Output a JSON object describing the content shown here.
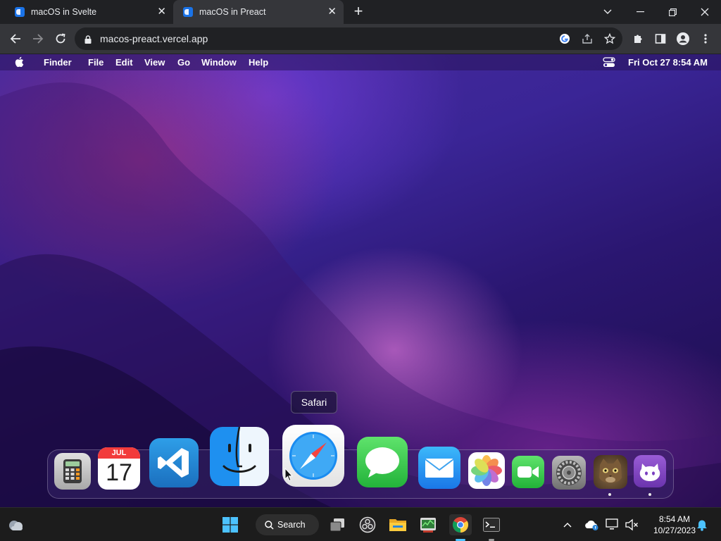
{
  "browser": {
    "tabs": [
      {
        "title": "macOS in Svelte",
        "active": false
      },
      {
        "title": "macOS in Preact",
        "active": true
      }
    ],
    "url": "macos-preact.vercel.app"
  },
  "menubar": {
    "app_name": "Finder",
    "items": [
      "File",
      "Edit",
      "View",
      "Go",
      "Window",
      "Help"
    ],
    "clock": "Fri Oct 27  8:54 AM"
  },
  "dock": {
    "tooltip": "Safari",
    "calendar_month": "JUL",
    "calendar_day": "17",
    "apps": [
      {
        "name": "Calculator",
        "icon": "calculator-icon"
      },
      {
        "name": "Calendar",
        "icon": "calendar-icon"
      },
      {
        "name": "VS Code",
        "icon": "vscode-icon"
      },
      {
        "name": "Finder",
        "icon": "finder-icon"
      },
      {
        "name": "Safari",
        "icon": "safari-icon"
      },
      {
        "name": "Messages",
        "icon": "messages-icon"
      },
      {
        "name": "Mail",
        "icon": "mail-icon"
      },
      {
        "name": "Photos",
        "icon": "photos-icon"
      },
      {
        "name": "FaceTime",
        "icon": "facetime-icon"
      },
      {
        "name": "System Preferences",
        "icon": "settings-icon"
      },
      {
        "name": "Cat",
        "icon": "cat-icon",
        "running": true
      },
      {
        "name": "GitHub",
        "icon": "github-icon",
        "running": true
      }
    ]
  },
  "taskbar": {
    "search_label": "Search",
    "time": "8:54 AM",
    "date": "10/27/2023"
  },
  "colors": {
    "chrome_bg": "#202124",
    "chrome_toolbar": "#35363a",
    "taskbar_bg": "#1c1c1c",
    "accent_blue": "#1a73e8"
  }
}
